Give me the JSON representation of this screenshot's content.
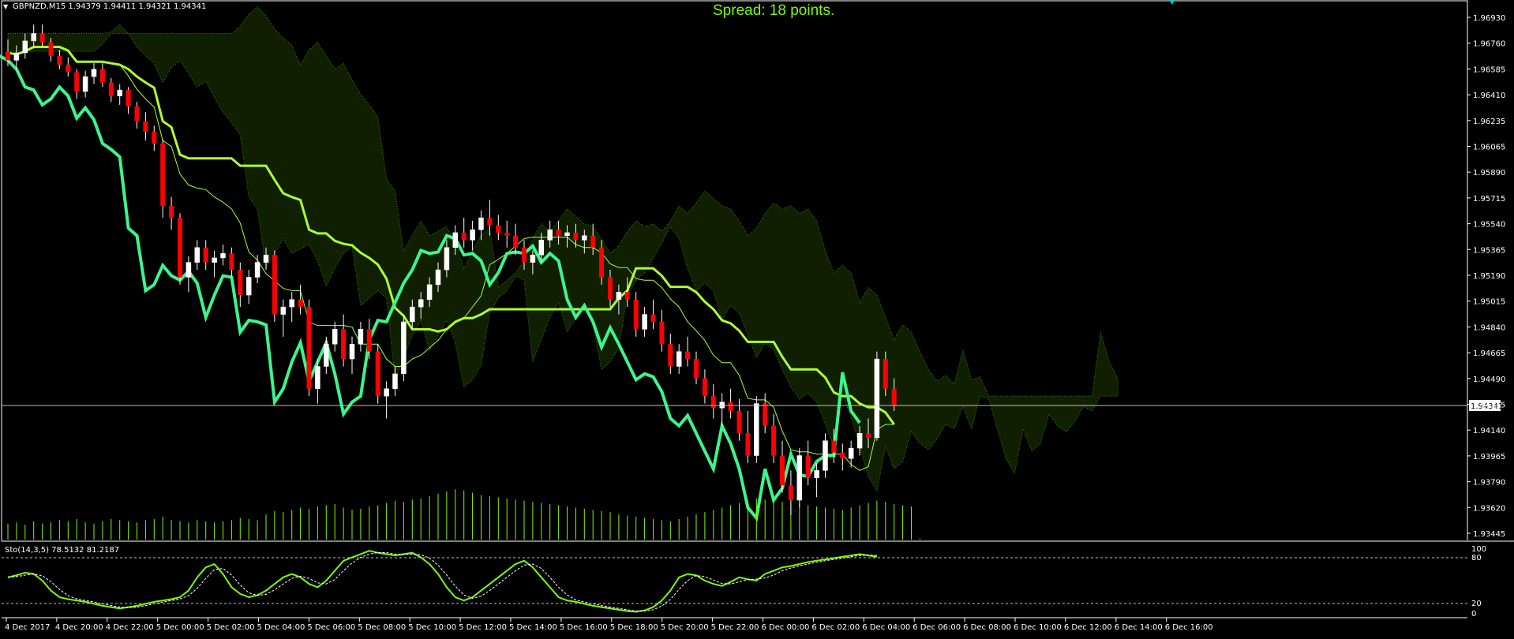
{
  "header": {
    "symbol_line": "GBPNZD,M15  1.94379 1.94411 1.94321 1.94341",
    "spread_text": "Spread: 18 points."
  },
  "price_scale": {
    "labels": [
      "1.96930",
      "1.96760",
      "1.96585",
      "1.96410",
      "1.96235",
      "1.96065",
      "1.95890",
      "1.95715",
      "1.95540",
      "1.95365",
      "1.95190",
      "1.95015",
      "1.94840",
      "1.94665",
      "1.94490",
      "1.94315",
      "1.94140",
      "1.93965",
      "1.93790",
      "1.93620",
      "1.93445"
    ],
    "current_price": "1.94341"
  },
  "stochastic": {
    "label": "Sto(14,3,5) 78.5132 81.2187",
    "scale_labels": [
      "100",
      "80",
      "20",
      "0"
    ]
  },
  "time_axis": {
    "labels": [
      "4 Dec 2017",
      "4 Dec 20:00",
      "4 Dec 22:00",
      "5 Dec 00:00",
      "5 Dec 02:00",
      "5 Dec 04:00",
      "5 Dec 06:00",
      "5 Dec 08:00",
      "5 Dec 10:00",
      "5 Dec 12:00",
      "5 Dec 14:00",
      "5 Dec 16:00",
      "5 Dec 18:00",
      "5 Dec 20:00",
      "5 Dec 22:00",
      "6 Dec 00:00",
      "6 Dec 02:00",
      "6 Dec 04:00",
      "6 Dec 06:00",
      "6 Dec 08:00",
      "6 Dec 10:00",
      "6 Dec 12:00",
      "6 Dec 14:00",
      "6 Dec 16:00"
    ]
  },
  "colors": {
    "background": "#000000",
    "bull_candle": "#ffffff",
    "bear_candle": "#ff0000",
    "kijun": "#adff2f",
    "chikou": "#3cf58c",
    "cloud": "#7fff00",
    "volume": "#7cfc00",
    "stoch_main": "#7cfc00"
  },
  "chart_data": {
    "type": "candlestick",
    "symbol": "GBPNZD",
    "timeframe": "M15",
    "ylim": [
      1.9344,
      1.9697
    ],
    "candles": [
      [
        1.9672,
        1.968,
        1.9662,
        1.9666
      ],
      [
        1.9666,
        1.9676,
        1.966,
        1.9671
      ],
      [
        1.9671,
        1.9684,
        1.9667,
        1.9679
      ],
      [
        1.9679,
        1.969,
        1.9674,
        1.9684
      ],
      [
        1.9684,
        1.969,
        1.9675,
        1.9678
      ],
      [
        1.9678,
        1.9681,
        1.9665,
        1.9669
      ],
      [
        1.9669,
        1.9673,
        1.966,
        1.9663
      ],
      [
        1.9663,
        1.9668,
        1.9655,
        1.9658
      ],
      [
        1.9658,
        1.966,
        1.964,
        1.9645
      ],
      [
        1.9645,
        1.9659,
        1.9641,
        1.9655
      ],
      [
        1.9655,
        1.9664,
        1.965,
        1.966
      ],
      [
        1.966,
        1.9664,
        1.9648,
        1.9651
      ],
      [
        1.9651,
        1.9654,
        1.9638,
        1.9642
      ],
      [
        1.9642,
        1.965,
        1.9636,
        1.9646
      ],
      [
        1.9646,
        1.9648,
        1.963,
        1.9635
      ],
      [
        1.9635,
        1.9638,
        1.962,
        1.9625
      ],
      [
        1.9625,
        1.9631,
        1.9612,
        1.9618
      ],
      [
        1.9618,
        1.9622,
        1.9605,
        1.961
      ],
      [
        1.961,
        1.9613,
        1.956,
        1.9568
      ],
      [
        1.9568,
        1.9574,
        1.9552,
        1.956
      ],
      [
        1.956,
        1.9563,
        1.9515,
        1.952
      ],
      [
        1.952,
        1.9534,
        1.951,
        1.953
      ],
      [
        1.953,
        1.9545,
        1.9525,
        1.954
      ],
      [
        1.954,
        1.9545,
        1.9525,
        1.953
      ],
      [
        1.953,
        1.9538,
        1.952,
        1.9533
      ],
      [
        1.9533,
        1.9542,
        1.9528,
        1.9536
      ],
      [
        1.9536,
        1.954,
        1.952,
        1.9525
      ],
      [
        1.9525,
        1.953,
        1.95,
        1.9508
      ],
      [
        1.9508,
        1.9525,
        1.9502,
        1.952
      ],
      [
        1.952,
        1.9535,
        1.9516,
        1.953
      ],
      [
        1.953,
        1.954,
        1.9525,
        1.9535
      ],
      [
        1.9535,
        1.9538,
        1.949,
        1.9495
      ],
      [
        1.9495,
        1.9505,
        1.948,
        1.95
      ],
      [
        1.95,
        1.951,
        1.949,
        1.9505
      ],
      [
        1.9505,
        1.9515,
        1.9495,
        1.95
      ],
      [
        1.95,
        1.9505,
        1.944,
        1.9445
      ],
      [
        1.9445,
        1.9465,
        1.9435,
        1.946
      ],
      [
        1.946,
        1.948,
        1.9455,
        1.9475
      ],
      [
        1.9475,
        1.949,
        1.947,
        1.9485
      ],
      [
        1.9485,
        1.9495,
        1.946,
        1.9465
      ],
      [
        1.9465,
        1.948,
        1.9455,
        1.9475
      ],
      [
        1.9475,
        1.949,
        1.947,
        1.9485
      ],
      [
        1.9485,
        1.9492,
        1.9465,
        1.947
      ],
      [
        1.947,
        1.9475,
        1.9435,
        1.944
      ],
      [
        1.944,
        1.945,
        1.9425,
        1.9445
      ],
      [
        1.9445,
        1.946,
        1.944,
        1.9455
      ],
      [
        1.9455,
        1.9495,
        1.945,
        1.949
      ],
      [
        1.949,
        1.9505,
        1.9485,
        1.95
      ],
      [
        1.95,
        1.951,
        1.9492,
        1.9505
      ],
      [
        1.9505,
        1.952,
        1.95,
        1.9515
      ],
      [
        1.9515,
        1.953,
        1.951,
        1.9525
      ],
      [
        1.9525,
        1.9545,
        1.952,
        1.954
      ],
      [
        1.954,
        1.9555,
        1.9535,
        1.955
      ],
      [
        1.955,
        1.956,
        1.954,
        1.9545
      ],
      [
        1.9545,
        1.9558,
        1.9538,
        1.9552
      ],
      [
        1.9552,
        1.9565,
        1.9545,
        1.956
      ],
      [
        1.956,
        1.9572,
        1.9548,
        1.9555
      ],
      [
        1.9555,
        1.9562,
        1.9545,
        1.955
      ],
      [
        1.955,
        1.9558,
        1.954,
        1.9548
      ],
      [
        1.9548,
        1.9556,
        1.9535,
        1.954
      ],
      [
        1.954,
        1.9545,
        1.9525,
        1.953
      ],
      [
        1.953,
        1.9538,
        1.9522,
        1.9535
      ],
      [
        1.9535,
        1.955,
        1.953,
        1.9545
      ],
      [
        1.9545,
        1.9558,
        1.954,
        1.9552
      ],
      [
        1.9552,
        1.9558,
        1.9542,
        1.9548
      ],
      [
        1.9548,
        1.9555,
        1.954,
        1.955
      ],
      [
        1.955,
        1.9556,
        1.954,
        1.9545
      ],
      [
        1.9545,
        1.9552,
        1.9536,
        1.9548
      ],
      [
        1.9548,
        1.9556,
        1.9535,
        1.954
      ],
      [
        1.954,
        1.9545,
        1.9515,
        1.952
      ],
      [
        1.952,
        1.9525,
        1.95,
        1.9505
      ],
      [
        1.9505,
        1.9515,
        1.9495,
        1.951
      ],
      [
        1.951,
        1.952,
        1.95,
        1.9505
      ],
      [
        1.9505,
        1.951,
        1.948,
        1.9485
      ],
      [
        1.9485,
        1.95,
        1.948,
        1.9495
      ],
      [
        1.9495,
        1.9505,
        1.9485,
        1.949
      ],
      [
        1.949,
        1.9498,
        1.947,
        1.9475
      ],
      [
        1.9475,
        1.9482,
        1.9455,
        1.946
      ],
      [
        1.946,
        1.9475,
        1.9455,
        1.947
      ],
      [
        1.947,
        1.948,
        1.946,
        1.9465
      ],
      [
        1.9465,
        1.947,
        1.9448,
        1.9452
      ],
      [
        1.9452,
        1.9458,
        1.9435,
        1.944
      ],
      [
        1.944,
        1.9448,
        1.9425,
        1.9432
      ],
      [
        1.9432,
        1.9442,
        1.942,
        1.9436
      ],
      [
        1.9436,
        1.9445,
        1.9425,
        1.943
      ],
      [
        1.943,
        1.9438,
        1.941,
        1.9415
      ],
      [
        1.9415,
        1.943,
        1.9395,
        1.94
      ],
      [
        1.94,
        1.944,
        1.9395,
        1.9435
      ],
      [
        1.9435,
        1.9442,
        1.9415,
        1.942
      ],
      [
        1.942,
        1.9428,
        1.9395,
        1.94
      ],
      [
        1.94,
        1.941,
        1.9375,
        1.938
      ],
      [
        1.938,
        1.939,
        1.936,
        1.937
      ],
      [
        1.937,
        1.9405,
        1.9365,
        1.94
      ],
      [
        1.94,
        1.941,
        1.938,
        1.9385
      ],
      [
        1.9385,
        1.9395,
        1.9372,
        1.939
      ],
      [
        1.939,
        1.9415,
        1.9385,
        1.941
      ],
      [
        1.941,
        1.9418,
        1.9395,
        1.9402
      ],
      [
        1.9402,
        1.9408,
        1.939,
        1.9398
      ],
      [
        1.9398,
        1.941,
        1.9392,
        1.9405
      ],
      [
        1.9405,
        1.942,
        1.94,
        1.9415
      ],
      [
        1.9415,
        1.9425,
        1.9405,
        1.9412
      ],
      [
        1.9412,
        1.947,
        1.941,
        1.9465
      ],
      [
        1.9465,
        1.947,
        1.944,
        1.9445
      ],
      [
        1.9445,
        1.9452,
        1.943,
        1.9434
      ]
    ],
    "volume": [
      14,
      15,
      13,
      16,
      14,
      15,
      17,
      16,
      18,
      15,
      14,
      16,
      18,
      17,
      16,
      15,
      17,
      18,
      20,
      17,
      16,
      15,
      17,
      16,
      15,
      16,
      17,
      19,
      18,
      17,
      22,
      25,
      24,
      26,
      28,
      27,
      29,
      30,
      31,
      28,
      26,
      27,
      29,
      30,
      32,
      34,
      33,
      35,
      36,
      38,
      40,
      42,
      44,
      43,
      41,
      39,
      38,
      37,
      36,
      35,
      34,
      33,
      32,
      31,
      30,
      29,
      28,
      27,
      26,
      25,
      24,
      22,
      21,
      20,
      19,
      18,
      17,
      16,
      18,
      20,
      22,
      24,
      26,
      28,
      30,
      32,
      34,
      36,
      35,
      34,
      33,
      32,
      31,
      30,
      29,
      28,
      27,
      26,
      28,
      30,
      32,
      34,
      33,
      31,
      30,
      29,
      1
    ],
    "stochastic_k": [
      55,
      58,
      62,
      60,
      50,
      35,
      25,
      22,
      20,
      18,
      15,
      12,
      10,
      8,
      10,
      12,
      15,
      18,
      20,
      22,
      25,
      35,
      55,
      70,
      75,
      60,
      40,
      30,
      25,
      28,
      35,
      45,
      55,
      60,
      55,
      45,
      40,
      50,
      65,
      80,
      85,
      90,
      95,
      92,
      90,
      88,
      90,
      92,
      85,
      75,
      60,
      40,
      25,
      20,
      25,
      35,
      45,
      55,
      65,
      75,
      80,
      70,
      55,
      40,
      25,
      20,
      18,
      15,
      12,
      10,
      8,
      6,
      4,
      3,
      5,
      10,
      20,
      35,
      55,
      60,
      58,
      50,
      45,
      42,
      48,
      55,
      52,
      50,
      60,
      65,
      70,
      72,
      75,
      78,
      80,
      82,
      84,
      86,
      88,
      90,
      88,
      86
    ]
  }
}
